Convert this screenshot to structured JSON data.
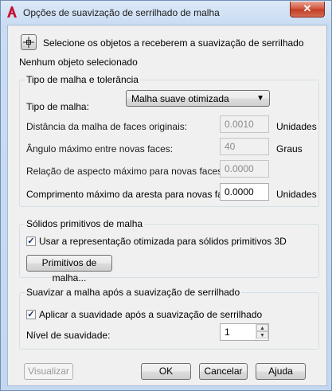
{
  "window": {
    "title": "Opções de suavização de serrilhado de malha",
    "close_label": "✕"
  },
  "select_objects": {
    "label": "Selecione os objetos a receberem a suavização de serrilhado",
    "status": "Nenhum objeto selecionado"
  },
  "mesh_type_group": {
    "title": "Tipo de malha e tolerância",
    "mesh_type_label": "Tipo de malha:",
    "mesh_type_value": "Malha suave otimizada",
    "distance_label": "Distância da malha de faces originais:",
    "distance_value": "0.0010",
    "distance_unit": "Unidades",
    "angle_label": "Ângulo máximo entre novas faces:",
    "angle_value": "40",
    "angle_unit": "Graus",
    "aspect_label": "Relação de aspecto máximo para novas faces:",
    "aspect_value": "0.0000",
    "edge_label": "Comprimento máximo da aresta para novas faces:",
    "edge_value": "0.0000",
    "edge_unit": "Unidades"
  },
  "primitives_group": {
    "title": "Sólidos primitivos de malha",
    "checkbox_label": "Usar a representação otimizada para sólidos primitivos 3D",
    "checked": true,
    "button_label": "Primitivos de malha..."
  },
  "smooth_group": {
    "title": "Suavizar a malha após a suavização de serrilhado",
    "checkbox_label": "Aplicar a suavidade após a suavização de serrilhado",
    "checked": true,
    "level_label": "Nível de suavidade:",
    "level_value": "1"
  },
  "buttons": {
    "preview": "Visualizar",
    "ok": "OK",
    "cancel": "Cancelar",
    "help": "Ajuda"
  }
}
